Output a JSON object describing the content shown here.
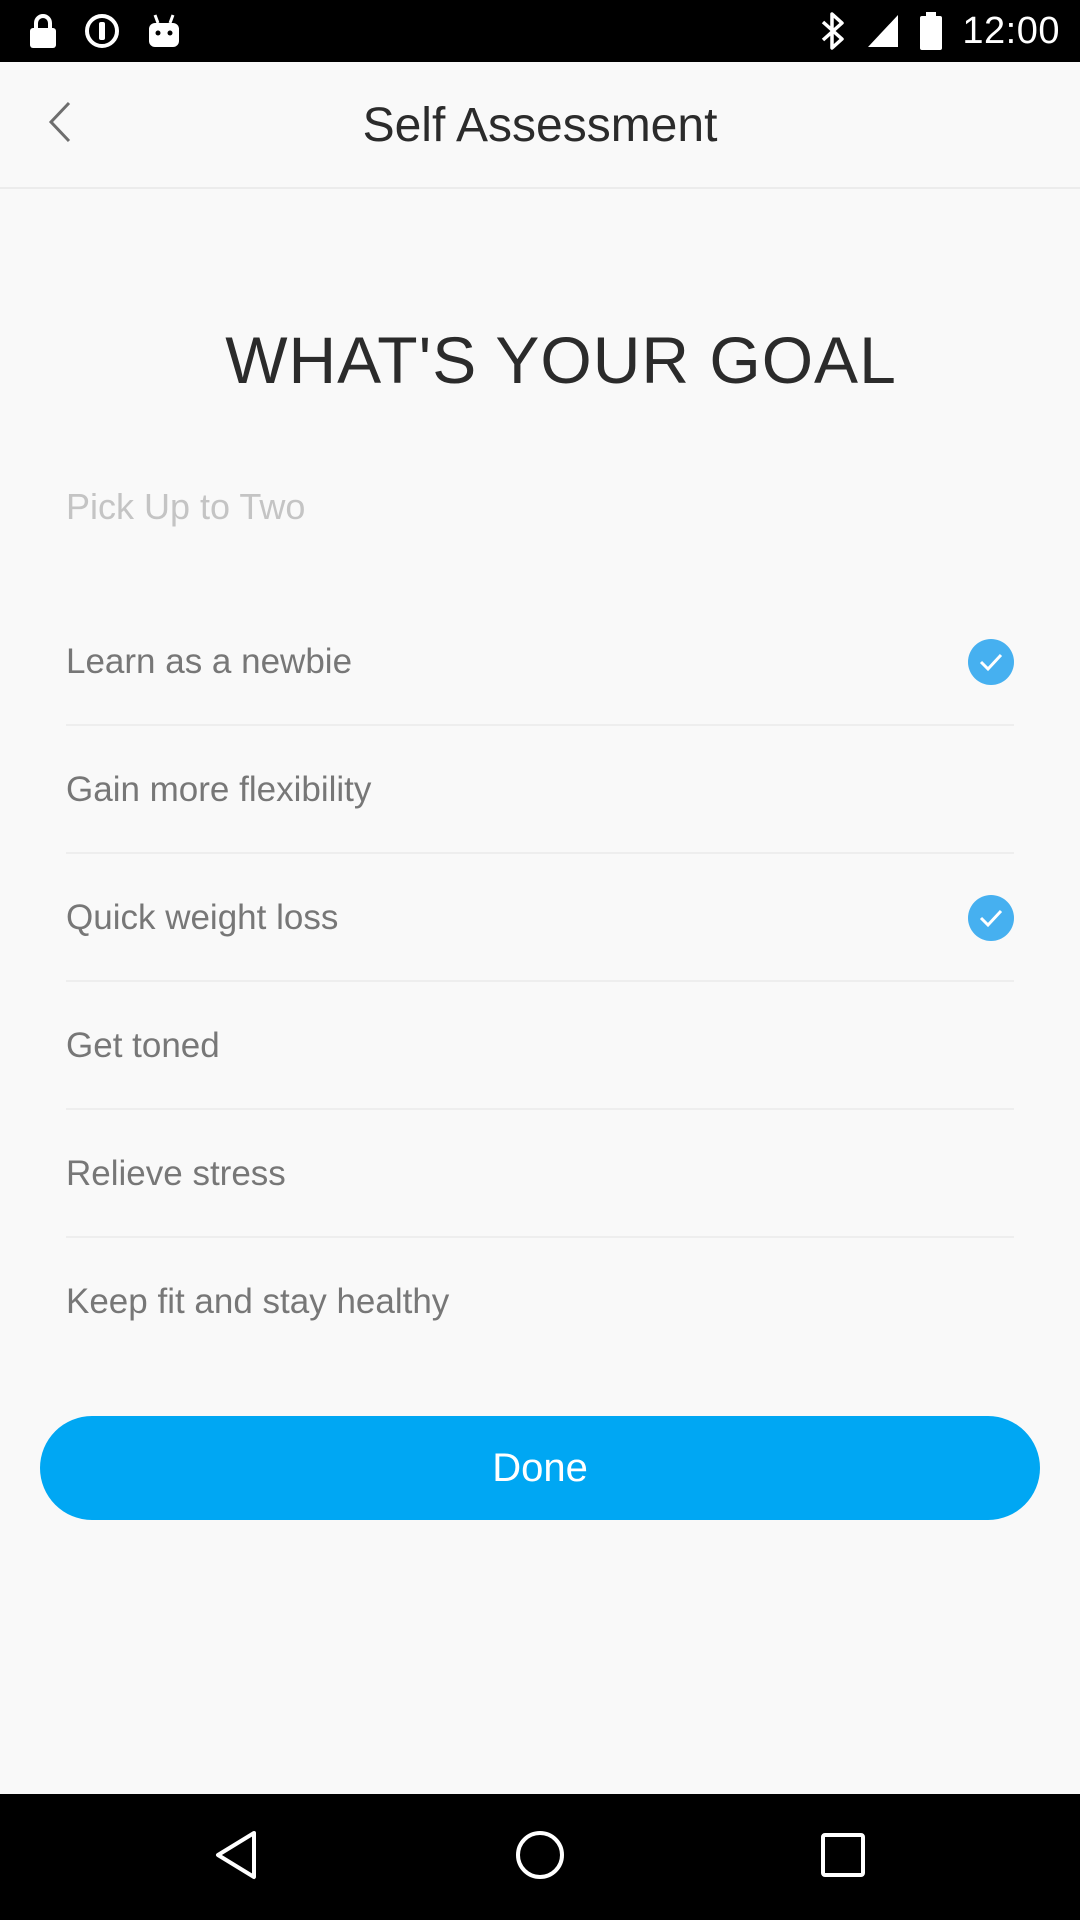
{
  "status_bar": {
    "time": "12:00",
    "icons": [
      "lock-icon",
      "sync-icon",
      "android-icon",
      "bluetooth-icon",
      "signal-icon",
      "battery-icon"
    ]
  },
  "header": {
    "title": "Self Assessment",
    "back_icon": "chevron-left-icon"
  },
  "main": {
    "heading": "WHAT'S YOUR GOAL",
    "hint": "Pick Up to Two",
    "options": [
      {
        "label": "Learn as a newbie",
        "selected": true
      },
      {
        "label": "Gain more flexibility",
        "selected": false
      },
      {
        "label": "Quick weight loss",
        "selected": true
      },
      {
        "label": "Get toned",
        "selected": false
      },
      {
        "label": "Relieve stress",
        "selected": false
      },
      {
        "label": "Keep fit and stay healthy",
        "selected": false
      }
    ],
    "done_label": "Done"
  },
  "colors": {
    "accent": "#00a7f3",
    "check": "#46b0f0"
  },
  "nav_bar": {
    "icons": [
      "back-triangle-icon",
      "home-circle-icon",
      "recents-square-icon"
    ]
  }
}
